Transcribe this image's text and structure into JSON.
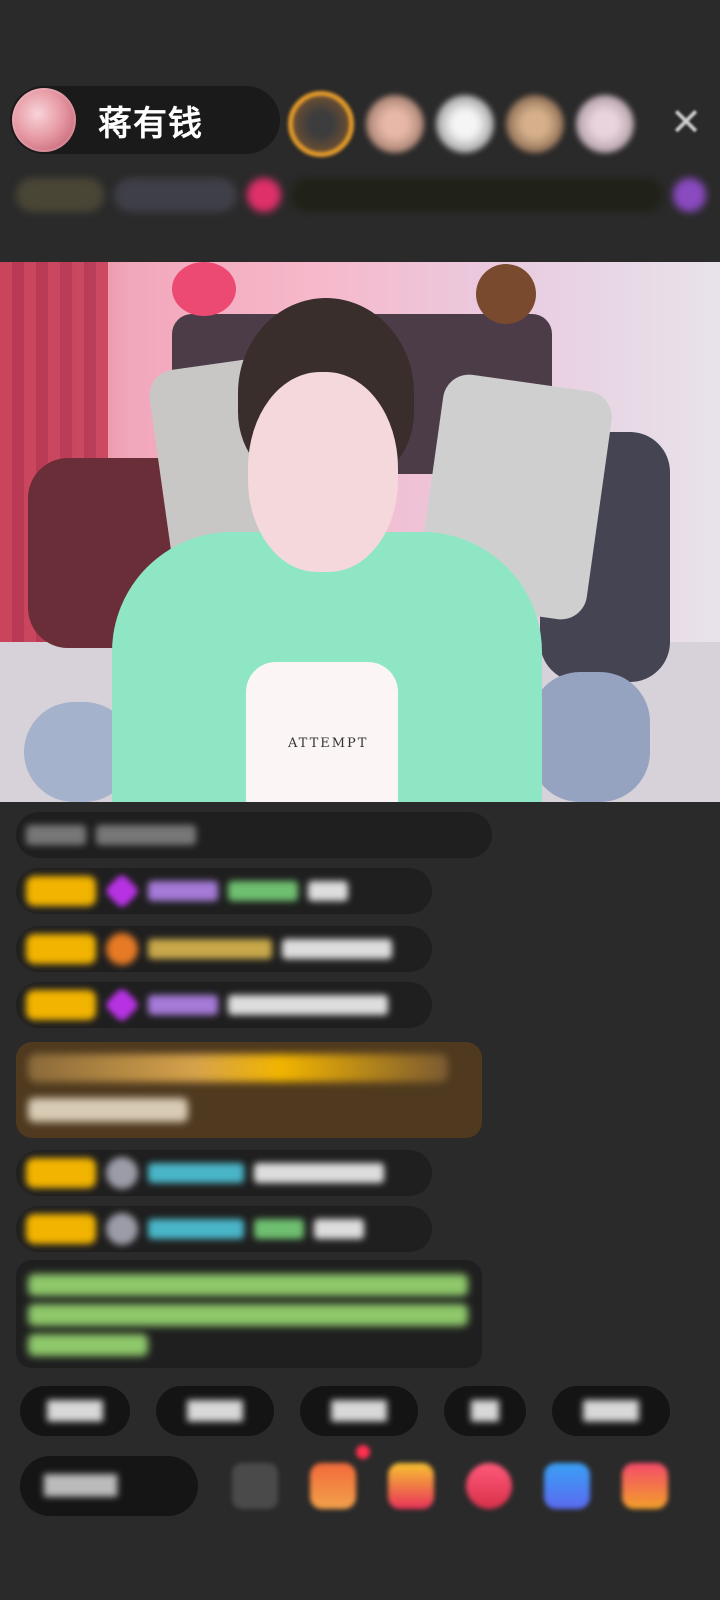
{
  "header": {
    "host_name": "蒋有钱",
    "close_icon_glyph": "✕"
  },
  "video": {
    "shirt_print": "ATTEMPT"
  },
  "colors": {
    "background": "#2a2a2a",
    "vip_badge": "#f2b400",
    "gift_highlight": "#4f3a1f",
    "rank1_ring": "#e39a2a",
    "notification_dot": "#ff3050"
  },
  "icons": {
    "close": "close-icon",
    "gift": "gift-icon",
    "emoji": "emoji-icon",
    "notification": "red-dot-icon"
  }
}
